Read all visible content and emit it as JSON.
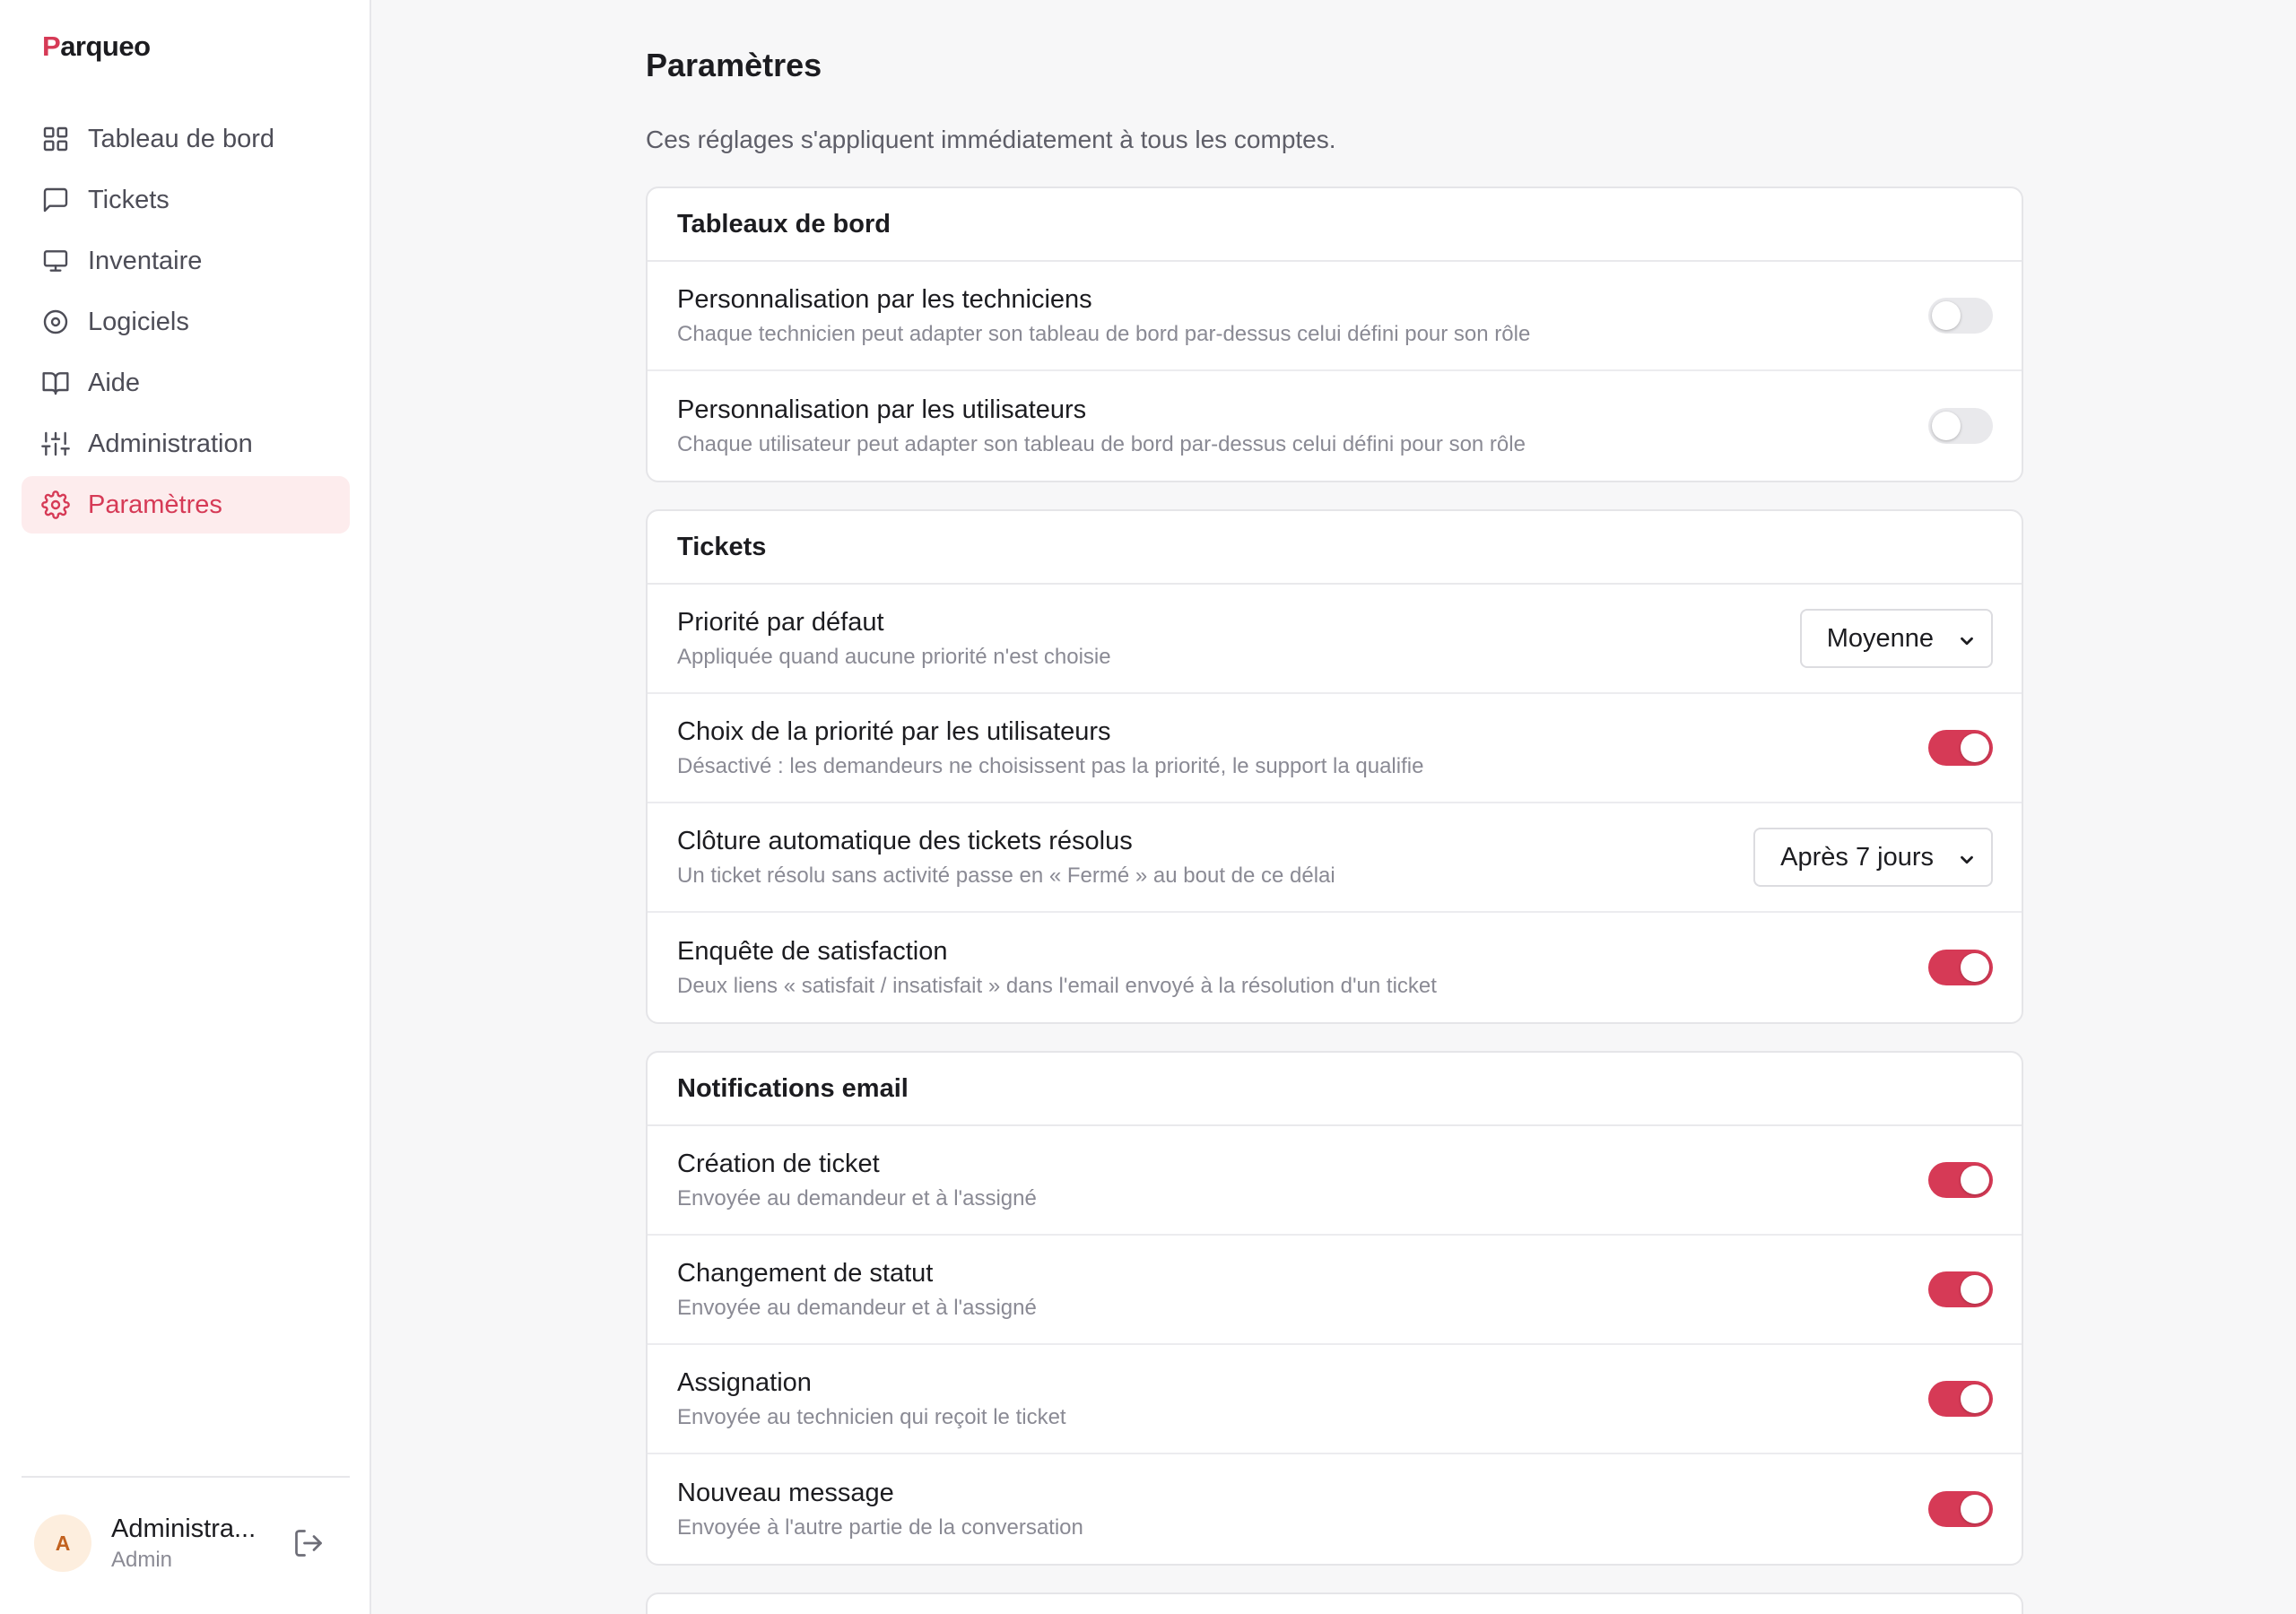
{
  "app": {
    "logo_mark": "P",
    "logo_rest": "arqueo"
  },
  "sidebar": {
    "items": [
      {
        "label": "Tableau de bord",
        "icon": "dashboard-grid-icon"
      },
      {
        "label": "Tickets",
        "icon": "message-square-icon"
      },
      {
        "label": "Inventaire",
        "icon": "monitor-icon"
      },
      {
        "label": "Logiciels",
        "icon": "disc-icon"
      },
      {
        "label": "Aide",
        "icon": "book-open-icon"
      },
      {
        "label": "Administration",
        "icon": "sliders-icon"
      },
      {
        "label": "Paramètres",
        "icon": "gear-icon",
        "active": true
      }
    ]
  },
  "user": {
    "initial": "A",
    "name": "Administra...",
    "role": "Admin"
  },
  "page": {
    "title": "Paramètres",
    "subtitle": "Ces réglages s'appliquent immédiatement à tous les comptes."
  },
  "sections": {
    "dashboards": {
      "title": "Tableaux de bord",
      "rows": [
        {
          "title": "Personnalisation par les techniciens",
          "desc": "Chaque technicien peut adapter son tableau de bord par-dessus celui défini pour son rôle",
          "enabled": false
        },
        {
          "title": "Personnalisation par les utilisateurs",
          "desc": "Chaque utilisateur peut adapter son tableau de bord par-dessus celui défini pour son rôle",
          "enabled": false
        }
      ]
    },
    "tickets": {
      "title": "Tickets",
      "rows": [
        {
          "title": "Priorité par défaut",
          "desc": "Appliquée quand aucune priorité n'est choisie",
          "value": "Moyenne"
        },
        {
          "title": "Choix de la priorité par les utilisateurs",
          "desc": "Désactivé : les demandeurs ne choisissent pas la priorité, le support la qualifie",
          "enabled": true
        },
        {
          "title": "Clôture automatique des tickets résolus",
          "desc": "Un ticket résolu sans activité passe en « Fermé » au bout de ce délai",
          "value": "Après 7 jours"
        },
        {
          "title": "Enquête de satisfaction",
          "desc": "Deux liens « satisfait / insatisfait » dans l'email envoyé à la résolution d'un ticket",
          "enabled": true
        }
      ]
    },
    "notifications": {
      "title": "Notifications email",
      "rows": [
        {
          "title": "Création de ticket",
          "desc": "Envoyée au demandeur et à l'assigné",
          "enabled": true
        },
        {
          "title": "Changement de statut",
          "desc": "Envoyée au demandeur et à l'assigné",
          "enabled": true
        },
        {
          "title": "Assignation",
          "desc": "Envoyée au technicien qui reçoit le ticket",
          "enabled": true
        },
        {
          "title": "Nouveau message",
          "desc": "Envoyée à l'autre partie de la conversation",
          "enabled": true
        }
      ]
    }
  },
  "colors": {
    "accent": "#d63a56",
    "accent_soft": "#fdeced",
    "toggle_off": "#e9e9ec"
  }
}
